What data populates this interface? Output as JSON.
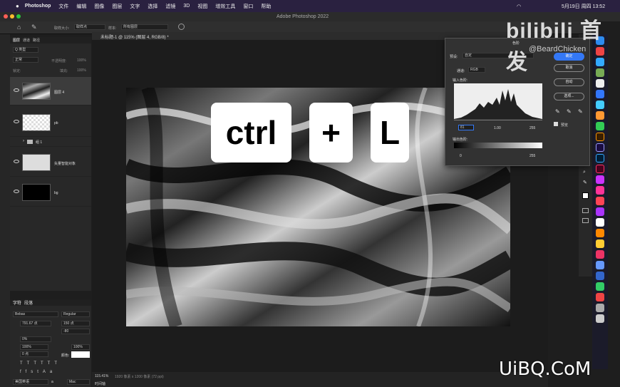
{
  "menubar": {
    "app": "Photoshop",
    "items": [
      "文件",
      "编辑",
      "图像",
      "图层",
      "文字",
      "选择",
      "滤镜",
      "3D",
      "视图",
      "增效工具",
      "窗口",
      "帮助"
    ],
    "clock": "5月19日 周四 13:52"
  },
  "window": {
    "title": "Adobe Photoshop 2022"
  },
  "options": {
    "sample_size_label": "取样大小:",
    "sample_size_value": "取样点",
    "sample_label": "样本:",
    "sample_value": "所有图层"
  },
  "doc": {
    "tab": "未标题-1 @ 115% (图层 4, RGB/8) *",
    "zoom": "115.41%",
    "info": "1920 像素 x 1200 像素 (72 ppi)"
  },
  "layers": {
    "tabs": [
      "图层",
      "通道",
      "路径"
    ],
    "kind": "Q 类型",
    "mode": "正常",
    "opacity_label": "不透明度:",
    "opacity": "100%",
    "lock_label": "锁定:",
    "fill_label": "填充:",
    "fill": "100%",
    "items": [
      {
        "name": "图层 4"
      },
      {
        "name": "pb"
      },
      {
        "name": "组 1"
      },
      {
        "name": "矢量智能对象"
      },
      {
        "name": "bg"
      }
    ]
  },
  "character": {
    "tabs": [
      "字符",
      "段落"
    ],
    "font": "Bebas",
    "style": "Regular",
    "size": "791.67 点",
    "leading": "150 点",
    "tracking": "-80",
    "scale": "0%",
    "vscale": "100%",
    "hscale": "100%",
    "baseline": "0 点",
    "color_label": "颜色:",
    "lang": "美国英语",
    "aa": "a",
    "aa_mode": "Mac",
    "timeline": "时间轴"
  },
  "keys": {
    "k1": "ctrl",
    "k2": "+",
    "k3": "L"
  },
  "levels": {
    "title": "色阶",
    "preset_label": "预设:",
    "preset": "自定",
    "channel_label": "通道:",
    "channel": "RGB",
    "input_label": "输入色阶:",
    "output_label": "输出色阶:",
    "in_black": "81",
    "in_mid": "1.00",
    "in_white": "255",
    "out_black": "0",
    "out_white": "255",
    "ok": "确定",
    "cancel": "取消",
    "auto": "自动",
    "options": "选项...",
    "preview": "预览"
  },
  "watermark": {
    "site": "bilibili 首发",
    "author": "@BeardChicken",
    "uibq": "UiBQ.CoM"
  },
  "colors": {
    "menubar": "#2a2140",
    "panel": "#282828",
    "accent": "#3478f6"
  }
}
